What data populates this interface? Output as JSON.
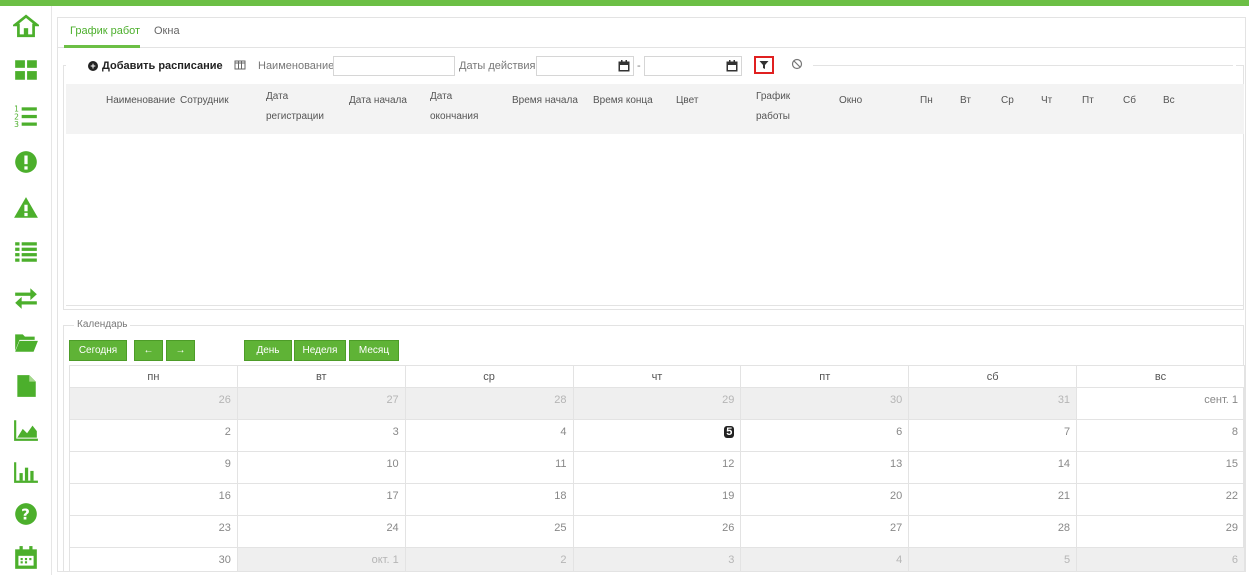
{
  "tabs": [
    {
      "label": "График работ",
      "active": true
    },
    {
      "label": "Окна",
      "active": false
    }
  ],
  "toolbar": {
    "add_label": "Добавить расписание",
    "name_label": "Наименование",
    "name_value": "",
    "dates_label": "Даты действия",
    "date_from_value": "",
    "date_sep": "-",
    "date_to_value": ""
  },
  "grid": {
    "columns": [
      "Наименование",
      "Сотрудник",
      "Дата регистрации",
      "Дата начала",
      "Дата окончания",
      "Время начала",
      "Время конца",
      "Цвет",
      "График работы",
      "Окно",
      "Пн",
      "Вт",
      "Ср",
      "Чт",
      "Пт",
      "Сб",
      "Вс"
    ],
    "rows": []
  },
  "calendar": {
    "legend": "Календарь",
    "buttons": {
      "today": "Сегодня",
      "prev": "←",
      "next": "→",
      "day": "День",
      "week": "Неделя",
      "month": "Месяц"
    },
    "weekdays": [
      "пн",
      "вт",
      "ср",
      "чт",
      "пт",
      "сб",
      "вс"
    ],
    "weeks": [
      [
        {
          "d": "26",
          "o": true
        },
        {
          "d": "27",
          "o": true
        },
        {
          "d": "28",
          "o": true
        },
        {
          "d": "29",
          "o": true
        },
        {
          "d": "30",
          "o": true
        },
        {
          "d": "31",
          "o": true
        },
        {
          "d": "сент. 1",
          "o": false
        }
      ],
      [
        {
          "d": "2",
          "o": false
        },
        {
          "d": "3",
          "o": false
        },
        {
          "d": "4",
          "o": false
        },
        {
          "d": "5",
          "o": false,
          "today": true
        },
        {
          "d": "6",
          "o": false
        },
        {
          "d": "7",
          "o": false
        },
        {
          "d": "8",
          "o": false
        }
      ],
      [
        {
          "d": "9",
          "o": false
        },
        {
          "d": "10",
          "o": false
        },
        {
          "d": "11",
          "o": false
        },
        {
          "d": "12",
          "o": false
        },
        {
          "d": "13",
          "o": false
        },
        {
          "d": "14",
          "o": false
        },
        {
          "d": "15",
          "o": false
        }
      ],
      [
        {
          "d": "16",
          "o": false
        },
        {
          "d": "17",
          "o": false
        },
        {
          "d": "18",
          "o": false
        },
        {
          "d": "19",
          "o": false
        },
        {
          "d": "20",
          "o": false
        },
        {
          "d": "21",
          "o": false
        },
        {
          "d": "22",
          "o": false
        }
      ],
      [
        {
          "d": "23",
          "o": false
        },
        {
          "d": "24",
          "o": false
        },
        {
          "d": "25",
          "o": false
        },
        {
          "d": "26",
          "o": false
        },
        {
          "d": "27",
          "o": false
        },
        {
          "d": "28",
          "o": false
        },
        {
          "d": "29",
          "o": false
        }
      ],
      [
        {
          "d": "30",
          "o": false
        },
        {
          "d": "окт. 1",
          "o": true
        },
        {
          "d": "2",
          "o": true
        },
        {
          "d": "3",
          "o": true
        },
        {
          "d": "4",
          "o": true
        },
        {
          "d": "5",
          "o": true
        },
        {
          "d": "6",
          "o": true
        }
      ]
    ]
  },
  "sidebar": {
    "icons": [
      "home-icon",
      "dashboard-icon",
      "numbered-list-icon",
      "alert-circle-icon",
      "warning-icon",
      "list-icon",
      "transfer-icon",
      "folder-open-icon",
      "document-icon",
      "area-chart-icon",
      "bar-chart-icon",
      "help-icon",
      "calendar-icon"
    ]
  },
  "colors": {
    "accent": "#6cbf45",
    "button": "#5fb336",
    "filter_highlight": "#e02020"
  }
}
